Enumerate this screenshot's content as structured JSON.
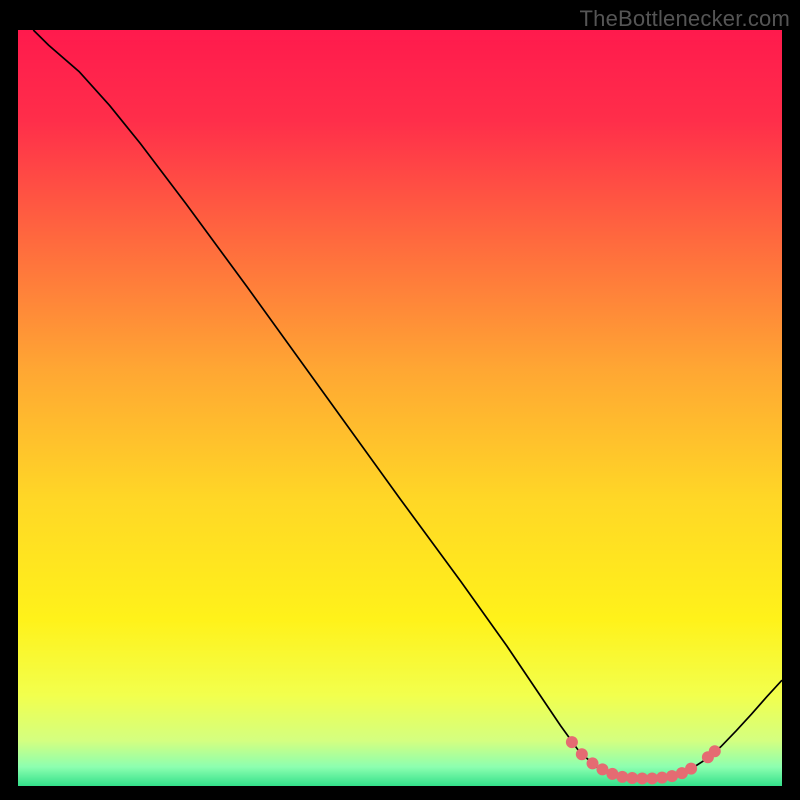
{
  "watermark": "TheBottlenecker.com",
  "chart_data": {
    "type": "line",
    "title": "",
    "xlabel": "",
    "ylabel": "",
    "xlim": [
      0,
      100
    ],
    "ylim": [
      0,
      100
    ],
    "background_gradient": {
      "stops": [
        {
          "offset": 0.0,
          "color": "#ff1a4d"
        },
        {
          "offset": 0.12,
          "color": "#ff2e4a"
        },
        {
          "offset": 0.28,
          "color": "#ff6a3e"
        },
        {
          "offset": 0.45,
          "color": "#ffa733"
        },
        {
          "offset": 0.62,
          "color": "#ffd726"
        },
        {
          "offset": 0.78,
          "color": "#fff21a"
        },
        {
          "offset": 0.88,
          "color": "#f2ff4d"
        },
        {
          "offset": 0.94,
          "color": "#d4ff80"
        },
        {
          "offset": 0.975,
          "color": "#8cffb0"
        },
        {
          "offset": 1.0,
          "color": "#33e08a"
        }
      ]
    },
    "series": [
      {
        "name": "bottleneck-curve",
        "stroke": "#000000",
        "points": [
          {
            "x": 2.0,
            "y": 100.0
          },
          {
            "x": 4.0,
            "y": 98.0
          },
          {
            "x": 8.0,
            "y": 94.5
          },
          {
            "x": 12.0,
            "y": 90.0
          },
          {
            "x": 16.0,
            "y": 85.0
          },
          {
            "x": 22.0,
            "y": 77.0
          },
          {
            "x": 30.0,
            "y": 66.0
          },
          {
            "x": 40.0,
            "y": 52.0
          },
          {
            "x": 50.0,
            "y": 38.0
          },
          {
            "x": 58.0,
            "y": 27.0
          },
          {
            "x": 64.0,
            "y": 18.5
          },
          {
            "x": 68.0,
            "y": 12.5
          },
          {
            "x": 71.0,
            "y": 8.0
          },
          {
            "x": 73.5,
            "y": 4.5
          },
          {
            "x": 76.0,
            "y": 2.3
          },
          {
            "x": 78.5,
            "y": 1.3
          },
          {
            "x": 81.0,
            "y": 1.0
          },
          {
            "x": 83.5,
            "y": 1.0
          },
          {
            "x": 86.0,
            "y": 1.4
          },
          {
            "x": 88.0,
            "y": 2.2
          },
          {
            "x": 90.0,
            "y": 3.5
          },
          {
            "x": 92.0,
            "y": 5.2
          },
          {
            "x": 94.0,
            "y": 7.3
          },
          {
            "x": 96.0,
            "y": 9.5
          },
          {
            "x": 98.0,
            "y": 11.8
          },
          {
            "x": 100.0,
            "y": 14.0
          }
        ]
      }
    ],
    "markers": {
      "color": "#e56b72",
      "radius": 6,
      "points": [
        {
          "x": 72.5,
          "y": 5.8
        },
        {
          "x": 73.8,
          "y": 4.2
        },
        {
          "x": 75.2,
          "y": 3.0
        },
        {
          "x": 76.5,
          "y": 2.2
        },
        {
          "x": 77.8,
          "y": 1.6
        },
        {
          "x": 79.1,
          "y": 1.2
        },
        {
          "x": 80.4,
          "y": 1.05
        },
        {
          "x": 81.7,
          "y": 1.0
        },
        {
          "x": 83.0,
          "y": 1.0
        },
        {
          "x": 84.3,
          "y": 1.1
        },
        {
          "x": 85.6,
          "y": 1.3
        },
        {
          "x": 86.9,
          "y": 1.7
        },
        {
          "x": 88.1,
          "y": 2.3
        },
        {
          "x": 90.3,
          "y": 3.8
        },
        {
          "x": 91.2,
          "y": 4.6
        }
      ]
    }
  }
}
